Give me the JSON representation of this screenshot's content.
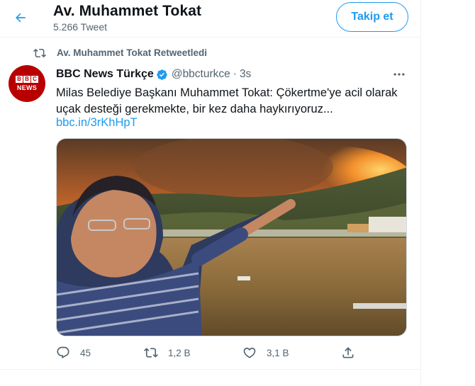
{
  "header": {
    "profile_name": "Av. Muhammet Tokat",
    "tweet_count": "5.266 Tweet",
    "follow_label": "Takip et"
  },
  "tweet": {
    "retweeted_by": "Av. Muhammet Tokat Retweetledi",
    "avatar": {
      "line1": [
        "B",
        "B",
        "C"
      ],
      "line2": "NEWS"
    },
    "author_name": "BBC News Türkçe",
    "author_handle": "@bbcturkce",
    "separator": "·",
    "time": "3s",
    "text": "Milas Belediye Başkanı Muhammet Tokat: Çökertme'ye acil olarak uçak desteği gerekmekte, bir kez daha haykırıyoruz...",
    "link": "bbc.in/3rKhHpT",
    "actions": {
      "replies": "45",
      "retweets": "1,2 B",
      "likes": "3,1 B"
    }
  },
  "colors": {
    "accent": "#1d9bf0",
    "muted": "#536471",
    "text": "#0f1419",
    "bbc_red": "#b80000"
  },
  "icons": [
    "back-arrow-icon",
    "retweet-icon",
    "verified-icon",
    "more-icon",
    "reply-icon",
    "like-icon",
    "share-icon"
  ]
}
